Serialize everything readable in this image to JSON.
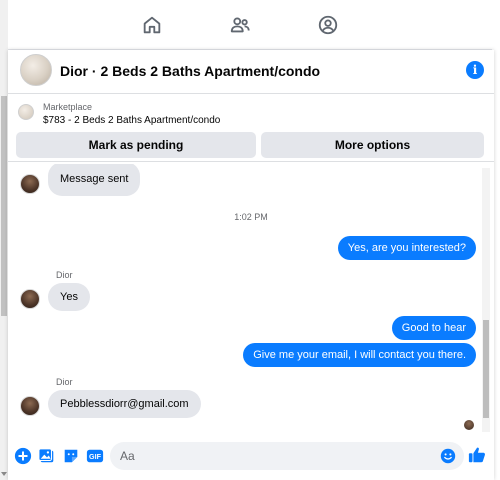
{
  "colors": {
    "accent": "#0a7cff",
    "bubble_incoming": "#e4e6eb",
    "nav_icon": "#606770"
  },
  "nav": {
    "icons": [
      "home-icon",
      "friends-icon",
      "groups-icon"
    ]
  },
  "header": {
    "title": "Dior · 2 Beds 2 Baths Apartment/condo",
    "info_icon": "i"
  },
  "marketplace": {
    "label": "Marketplace",
    "listing": "$783 - 2 Beds 2 Baths Apartment/condo",
    "mark_pending_label": "Mark as pending",
    "more_options_label": "More options"
  },
  "messages": {
    "first_incoming": "Message sent",
    "timestamp": "1:02 PM",
    "out_1": "Yes, are you interested?",
    "sender_1": "Dior",
    "in_2": "Yes",
    "out_2": "Good to hear",
    "out_3": "Give me your email, I will contact you there.",
    "sender_2": "Dior",
    "in_3": "Pebblessdiorr@gmail.com"
  },
  "composer": {
    "placeholder": "Aa",
    "icons": [
      "plus-icon",
      "photo-icon",
      "sticker-icon",
      "gif-icon",
      "emoji-icon",
      "thumbs-up-icon"
    ],
    "gif_text": "GIF"
  }
}
